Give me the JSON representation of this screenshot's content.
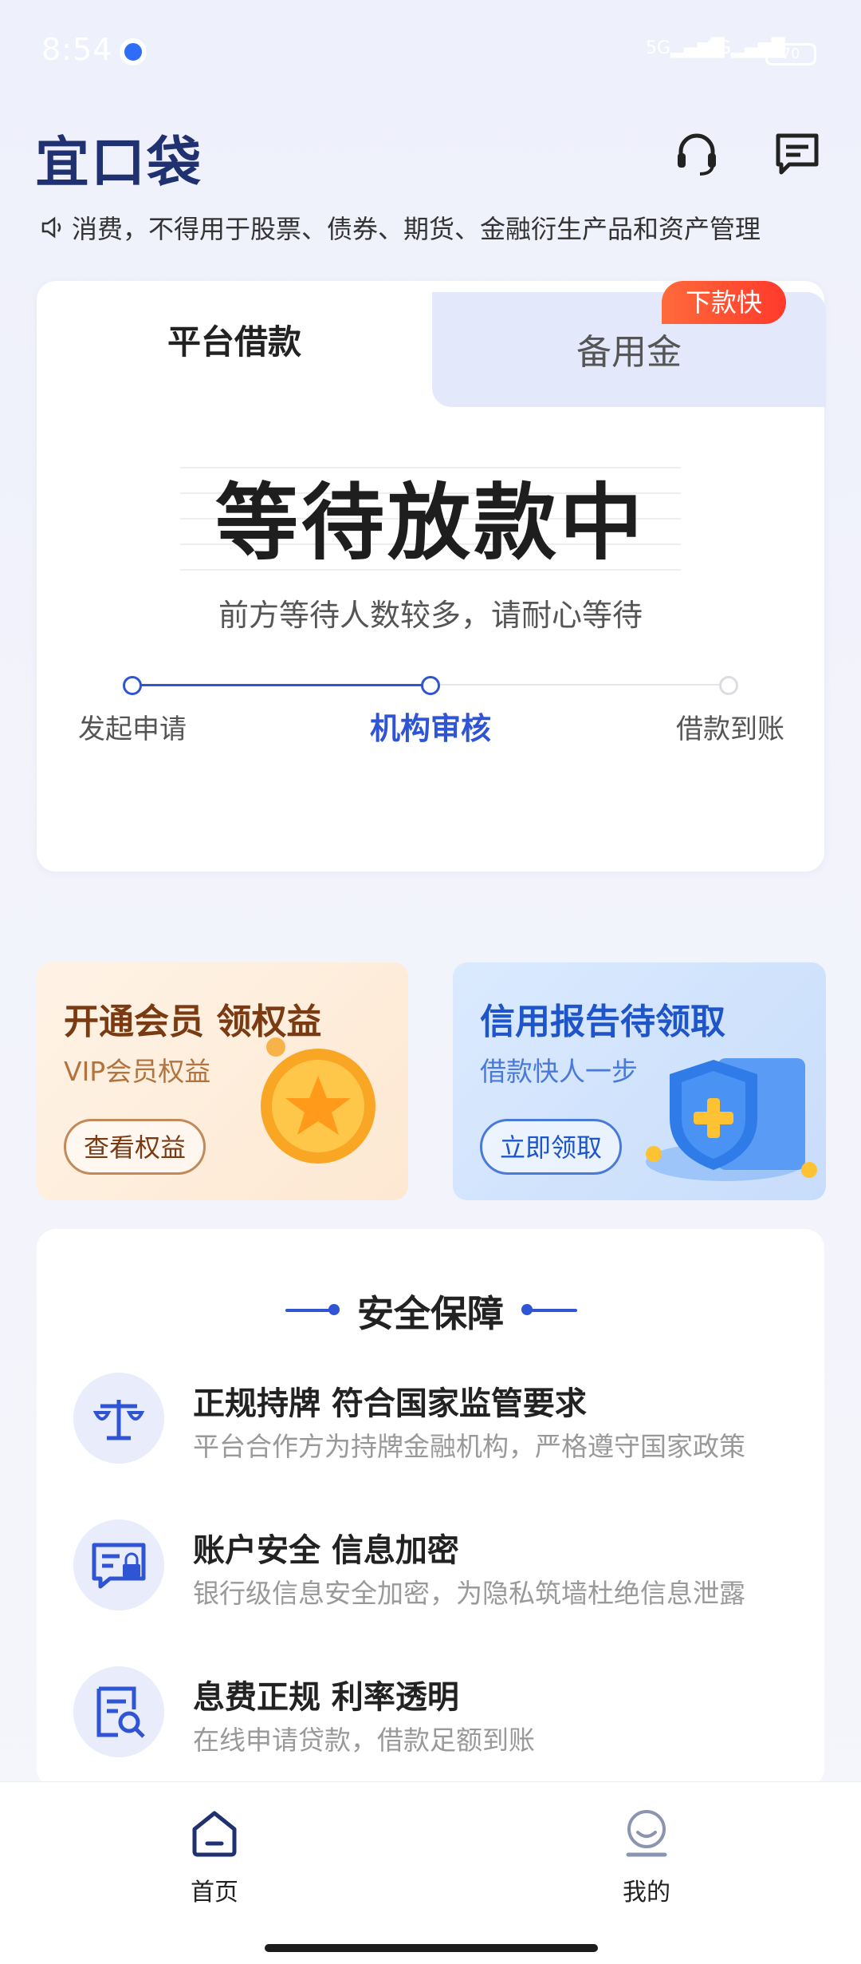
{
  "status": {
    "time": "8:54",
    "signal1": "5G",
    "signal2": "5G",
    "battery": "70"
  },
  "header": {
    "logo": "宜口袋",
    "support_icon": "headset-icon",
    "message_icon": "message-icon"
  },
  "notice": {
    "text": "消费，不得用于股票、债券、期货、金融衍生产品和资产管理"
  },
  "tabs": {
    "active": "平台借款",
    "inactive": "备用金",
    "badge": "下款快"
  },
  "status_panel": {
    "title": "等待放款中",
    "subtitle": "前方等待人数较多，请耐心等待",
    "steps": [
      "发起申请",
      "机构审核",
      "借款到账"
    ],
    "current_step": 2
  },
  "promos": [
    {
      "title": "开通会员  领权益",
      "subtitle": "VIP会员权益",
      "button": "查看权益"
    },
    {
      "title": "信用报告待领取",
      "subtitle": "借款快人一步",
      "button": "立即领取"
    }
  ],
  "security": {
    "title": "安全保障",
    "items": [
      {
        "icon": "scale-icon",
        "title": "正规持牌 符合国家监管要求",
        "desc": "平台合作方为持牌金融机构，严格遵守国家政策"
      },
      {
        "icon": "secure-chat-icon",
        "title": "账户安全 信息加密",
        "desc": "银行级信息安全加密，为隐私筑墙杜绝信息泄露"
      },
      {
        "icon": "document-search-icon",
        "title": "息费正规  利率透明",
        "desc": "在线申请贷款，借款足额到账"
      }
    ]
  },
  "nav": {
    "home": "首页",
    "mine": "我的"
  },
  "colors": {
    "primary": "#2f55d4",
    "badge": "#ff4a30",
    "logo": "#1f3170"
  }
}
